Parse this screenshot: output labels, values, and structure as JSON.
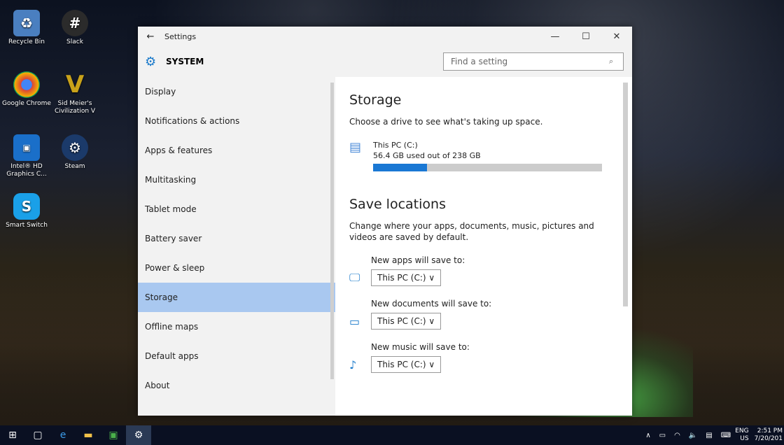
{
  "desktop": {
    "icons": [
      {
        "label": "Recycle Bin",
        "icon": "recycle-bin-icon",
        "color": "#4a7fc0"
      },
      {
        "label": "Slack",
        "icon": "slack-icon",
        "color": "#2b2b2b"
      },
      {
        "label": "Google Chrome",
        "icon": "chrome-icon",
        "color": "#db4437"
      },
      {
        "label": "Sid Meier's Civilization V",
        "icon": "civ-icon",
        "color": "#c9a21a"
      },
      {
        "label": "Intel® HD Graphics C...",
        "icon": "intel-icon",
        "color": "#1a6fc9"
      },
      {
        "label": "Steam",
        "icon": "steam-icon",
        "color": "#1b3a6a"
      },
      {
        "label": "Smart Switch",
        "icon": "smart-switch-icon",
        "color": "#1aa0e8"
      }
    ]
  },
  "window": {
    "title": "Settings",
    "back_glyph": "←",
    "minimize_glyph": "—",
    "maximize_glyph": "☐",
    "close_glyph": "✕"
  },
  "header": {
    "section": "SYSTEM",
    "search_placeholder": "Find a setting",
    "gear_glyph": "⚙",
    "search_glyph": "⌕"
  },
  "nav": {
    "items": [
      {
        "label": "Display",
        "selected": false
      },
      {
        "label": "Notifications & actions",
        "selected": false
      },
      {
        "label": "Apps & features",
        "selected": false
      },
      {
        "label": "Multitasking",
        "selected": false
      },
      {
        "label": "Tablet mode",
        "selected": false
      },
      {
        "label": "Battery saver",
        "selected": false
      },
      {
        "label": "Power & sleep",
        "selected": false
      },
      {
        "label": "Storage",
        "selected": true
      },
      {
        "label": "Offline maps",
        "selected": false
      },
      {
        "label": "Default apps",
        "selected": false
      },
      {
        "label": "About",
        "selected": false
      }
    ]
  },
  "content": {
    "title": "Storage",
    "description": "Choose a drive to see what's taking up space.",
    "drive": {
      "name": "This PC (C:)",
      "usage": "56.4 GB used out of 238 GB",
      "used_fraction": 0.237,
      "icon": "drive-icon"
    },
    "save_title": "Save locations",
    "save_description": "Change where your apps, documents, music, pictures and videos are saved by default.",
    "locations": [
      {
        "label": "New apps will save to:",
        "value": "This PC (C:)",
        "icon": "monitor-icon"
      },
      {
        "label": "New documents will save to:",
        "value": "This PC (C:)",
        "icon": "folder-icon"
      },
      {
        "label": "New music will save to:",
        "value": "This PC (C:)",
        "icon": "music-icon"
      }
    ],
    "chevron_glyph": "∨"
  },
  "taskbar": {
    "language_top": "ENG",
    "language_bottom": "US",
    "time": "2:51 PM",
    "date": "7/20/201",
    "accent": "#1a78d4"
  }
}
